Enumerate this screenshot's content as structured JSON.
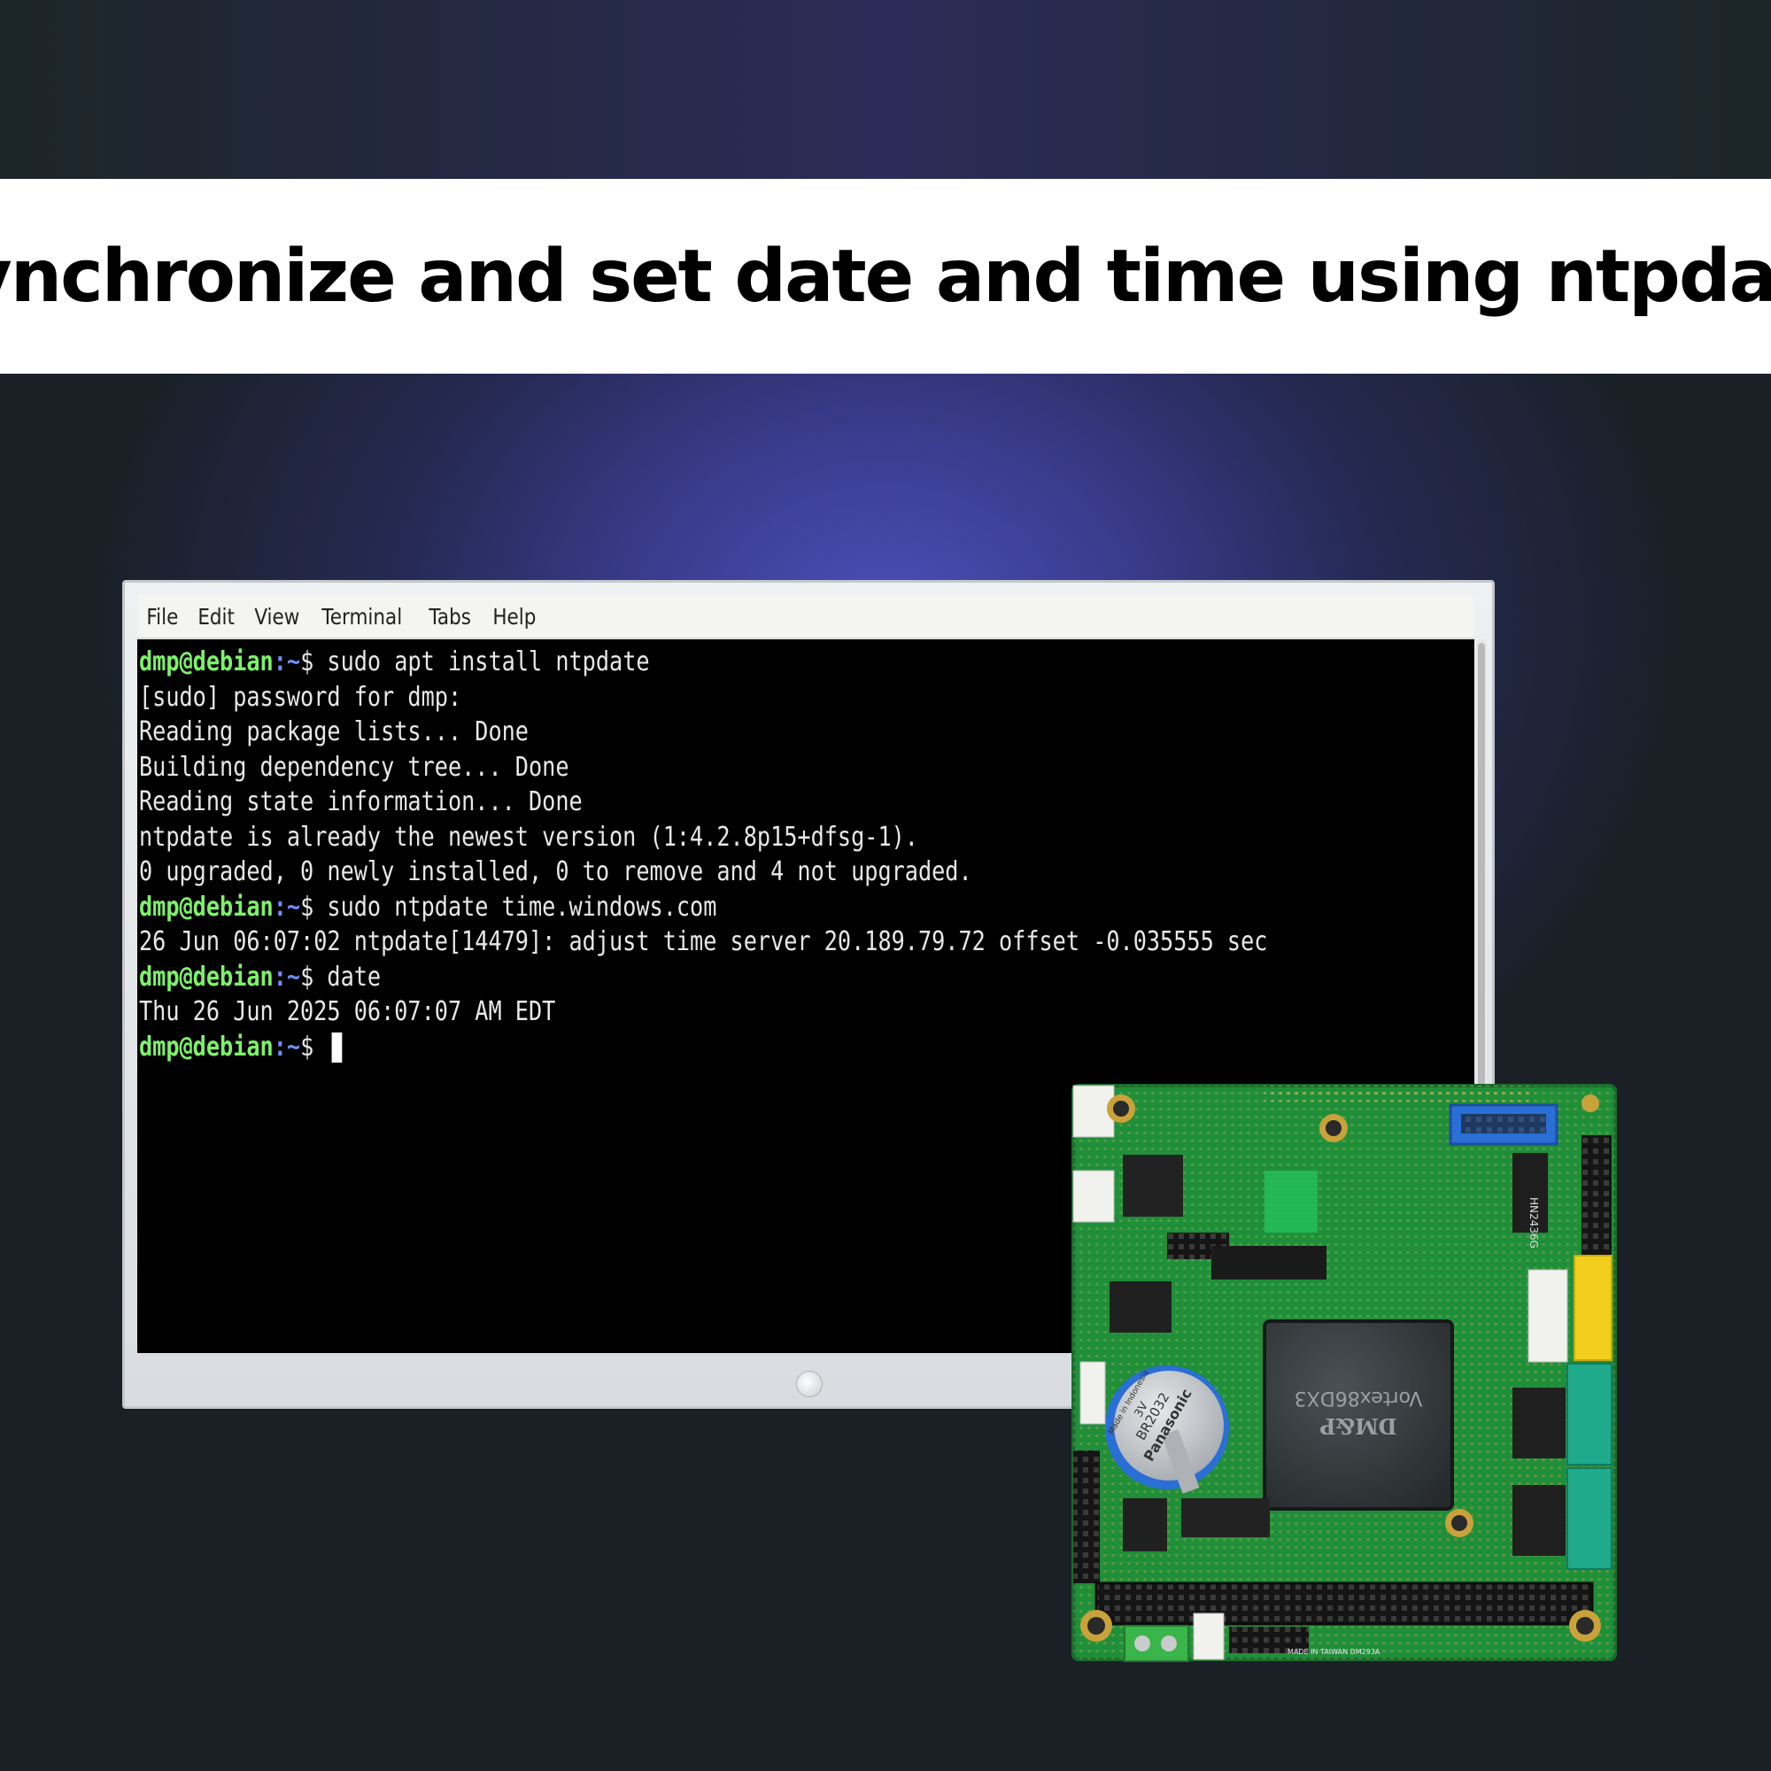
{
  "banner": {
    "title": "Synchronize and set date and time using ntpdate"
  },
  "terminal": {
    "menu": [
      "File",
      "Edit",
      "View",
      "Terminal",
      "Tabs",
      "Help"
    ],
    "prompt_user": "dmp@debian",
    "prompt_path": ":~",
    "prompt_symbol": "$",
    "lines": [
      {
        "type": "prompt",
        "cmd": " sudo apt install ntpdate"
      },
      {
        "type": "output",
        "text": "[sudo] password for dmp:"
      },
      {
        "type": "output",
        "text": "Reading package lists... Done"
      },
      {
        "type": "output",
        "text": "Building dependency tree... Done"
      },
      {
        "type": "output",
        "text": "Reading state information... Done"
      },
      {
        "type": "output",
        "text": "ntpdate is already the newest version (1:4.2.8p15+dfsg-1)."
      },
      {
        "type": "output",
        "text": "0 upgraded, 0 newly installed, 0 to remove and 4 not upgraded."
      },
      {
        "type": "prompt",
        "cmd": " sudo ntpdate time.windows.com"
      },
      {
        "type": "output",
        "text": "26 Jun 06:07:02 ntpdate[14479]: adjust time server 20.189.79.72 offset -0.035555 sec"
      },
      {
        "type": "prompt",
        "cmd": " date"
      },
      {
        "type": "output",
        "text": "Thu 26 Jun 2025 06:07:07 AM EDT"
      },
      {
        "type": "prompt",
        "cmd": " ",
        "cursor": true
      }
    ]
  },
  "board": {
    "chip_brand": "DM&P",
    "chip_model": "Vortex86DX3",
    "battery_brand": "Panasonic",
    "battery_model": "BR2032",
    "battery_voltage": "3V",
    "battery_origin": "Made in Indonesia",
    "footer": "MADE IN TAIWAN DM293A",
    "colors": {
      "pcb": "#1f8f3a",
      "chip": "#2f3436",
      "header_blue": "#2a6fd6",
      "header_yellow": "#f2cf1d",
      "header_teal": "#1faa8c"
    }
  }
}
